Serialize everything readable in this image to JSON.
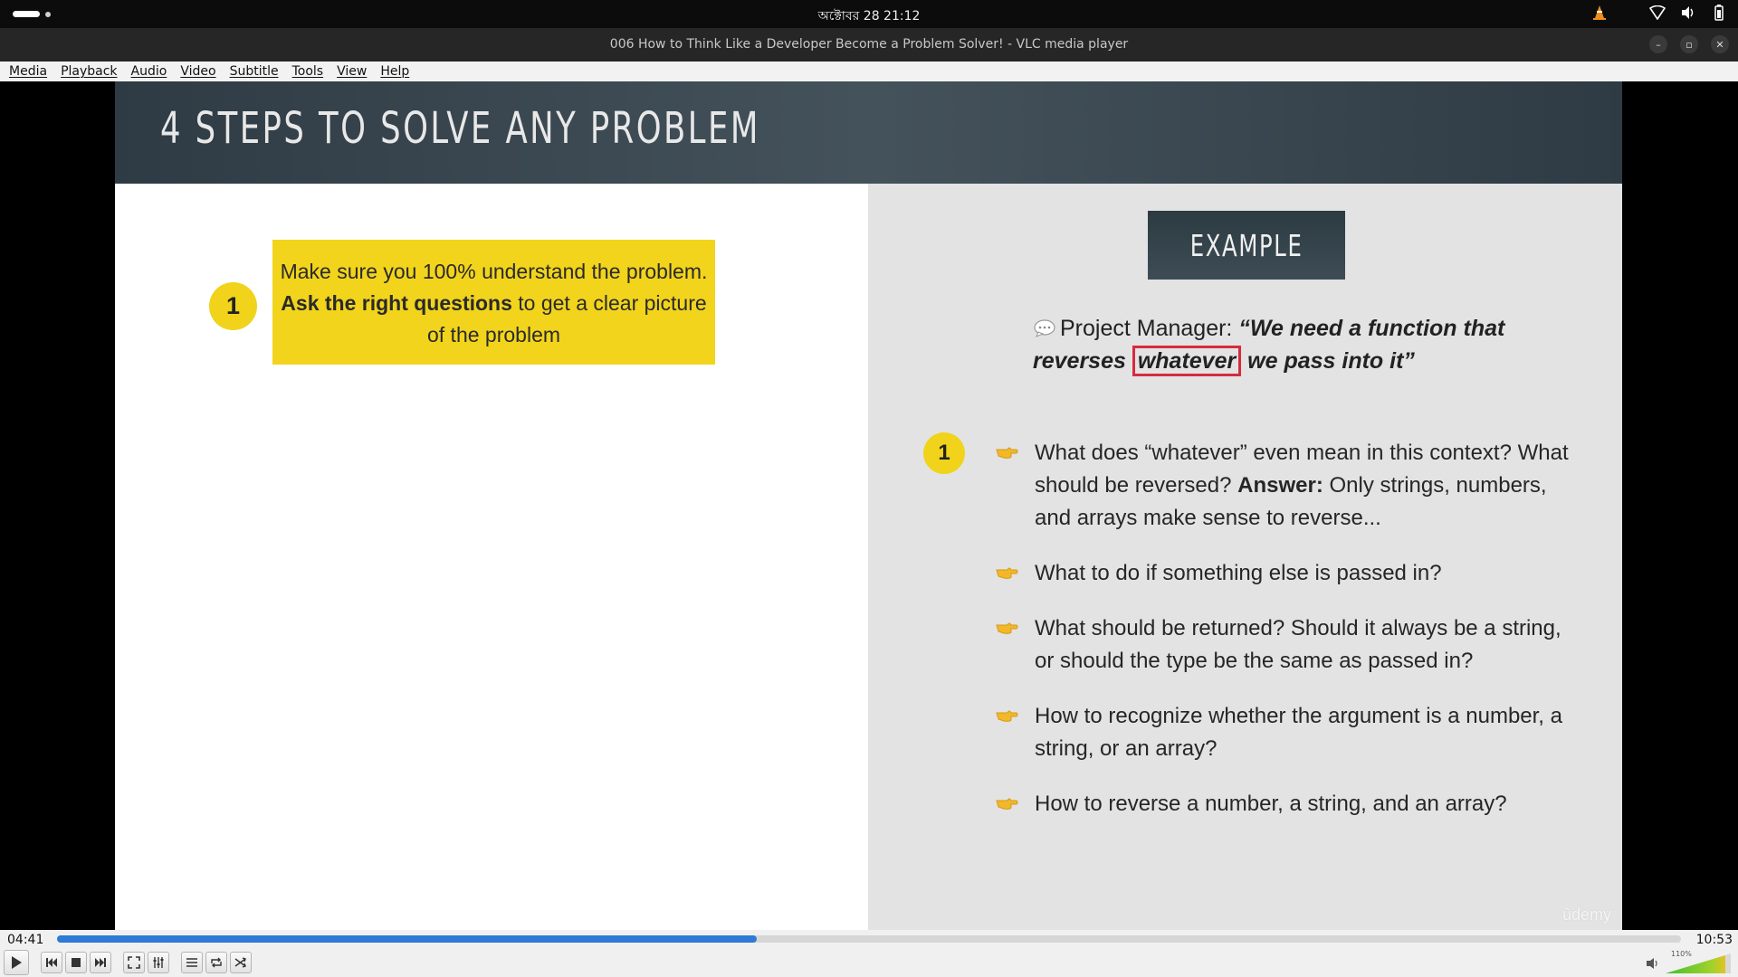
{
  "system": {
    "clock": "অক্টোবর 28  21:12"
  },
  "window": {
    "title": "006 How to Think Like a Developer Become a Problem Solver! - VLC media player"
  },
  "menu": [
    "Media",
    "Playback",
    "Audio",
    "Video",
    "Subtitle",
    "Tools",
    "View",
    "Help"
  ],
  "slide": {
    "title": "4 STEPS TO SOLVE ANY PROBLEM",
    "step_number": "1",
    "step_text_1": "Make sure you 100% understand the problem. ",
    "step_text_bold": "Ask the right questions",
    "step_text_2": " to get a clear picture of the problem",
    "example_label": "EXAMPLE",
    "quote_speaker": "Project Manager: ",
    "quote_part1": "“We need a function that reverses ",
    "quote_highlight": "whatever",
    "quote_part2": " we pass into it”",
    "bullet_number": "1",
    "bullets": [
      {
        "pre": "What does “whatever” even mean in this context? What should be reversed? ",
        "bold": "Answer:",
        "post": " Only strings, numbers, and arrays make sense to reverse..."
      },
      {
        "pre": "What to do if something else is passed in?",
        "bold": "",
        "post": ""
      },
      {
        "pre": "What should be returned? Should it always be a string, or should the type be the same as passed in?",
        "bold": "",
        "post": ""
      },
      {
        "pre": "How to recognize whether the argument is a number, a string, or an array?",
        "bold": "",
        "post": ""
      },
      {
        "pre": "How to reverse a number, a string, and an array?",
        "bold": "",
        "post": ""
      }
    ],
    "watermark": "ûdemy"
  },
  "player": {
    "time_current": "04:41",
    "time_total": "10:53",
    "progress_fraction": 0.431,
    "volume_label": "110%",
    "accent_color": "#2e7ad6"
  }
}
